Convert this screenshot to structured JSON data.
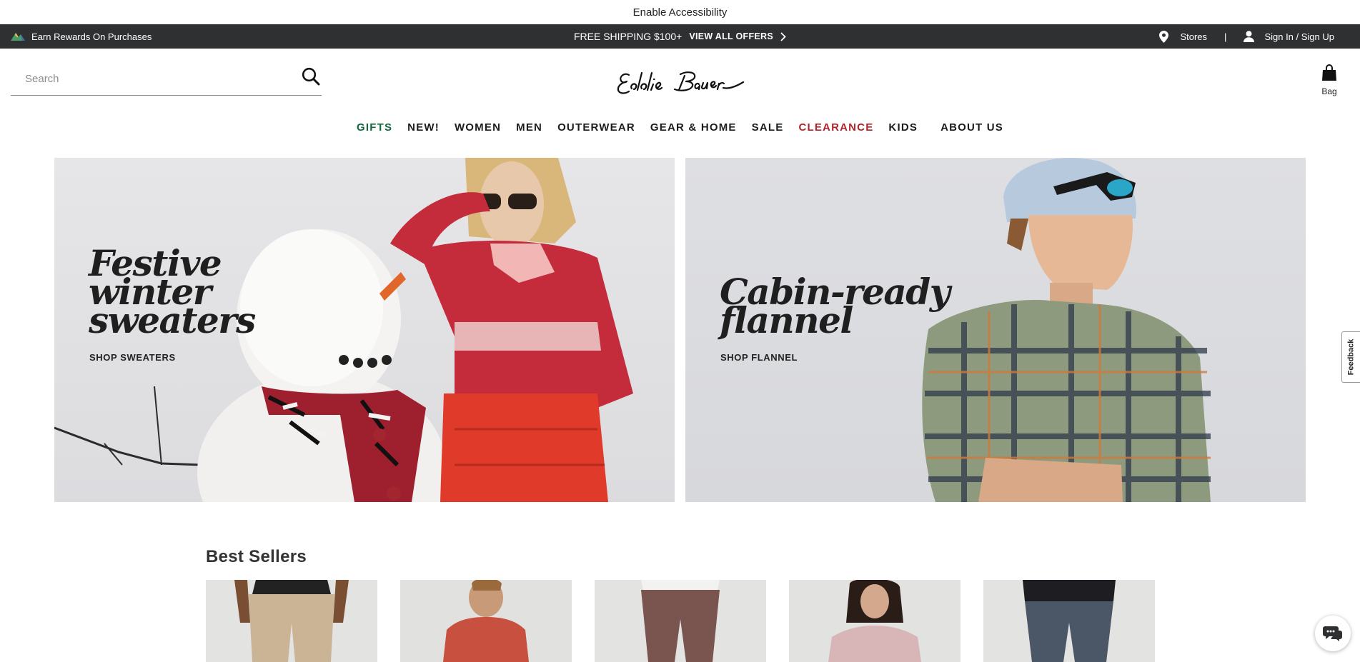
{
  "accessibility": {
    "label": "Enable Accessibility"
  },
  "promo": {
    "rewards_label": "Earn Rewards On Purchases",
    "shipping_label": "FREE SHIPPING $100+",
    "offers_label": "VIEW ALL OFFERS",
    "stores_label": "Stores",
    "separator": "|",
    "signin_label": "Sign In / Sign Up"
  },
  "header": {
    "search_placeholder": "Search",
    "logo_text": "Eddie Bauer",
    "bag_label": "Bag"
  },
  "nav": {
    "items": [
      {
        "label": "GIFTS",
        "color": "#0f6b3f"
      },
      {
        "label": "NEW!"
      },
      {
        "label": "WOMEN"
      },
      {
        "label": "MEN"
      },
      {
        "label": "OUTERWEAR"
      },
      {
        "label": "GEAR & HOME"
      },
      {
        "label": "SALE"
      },
      {
        "label": "CLEARANCE",
        "color": "#b4232a"
      },
      {
        "label": "KIDS"
      },
      {
        "label": "ABOUT US"
      }
    ]
  },
  "hero": {
    "left": {
      "title": "Festive\nwinter\nsweaters",
      "cta": "SHOP SWEATERS"
    },
    "right": {
      "title": "Cabin-ready\nflannel",
      "cta": "SHOP FLANNEL"
    }
  },
  "feedback": {
    "label": "Feedback"
  },
  "best_sellers": {
    "title": "Best Sellers",
    "products": [
      {
        "image": "khaki-pants-product"
      },
      {
        "image": "red-tshirt-product"
      },
      {
        "image": "brown-pants-product"
      },
      {
        "image": "pink-top-product"
      },
      {
        "image": "navy-pants-product"
      }
    ]
  },
  "colors": {
    "promo_bg": "#2e3032",
    "gifts": "#0f6b3f",
    "clearance": "#b4232a"
  }
}
